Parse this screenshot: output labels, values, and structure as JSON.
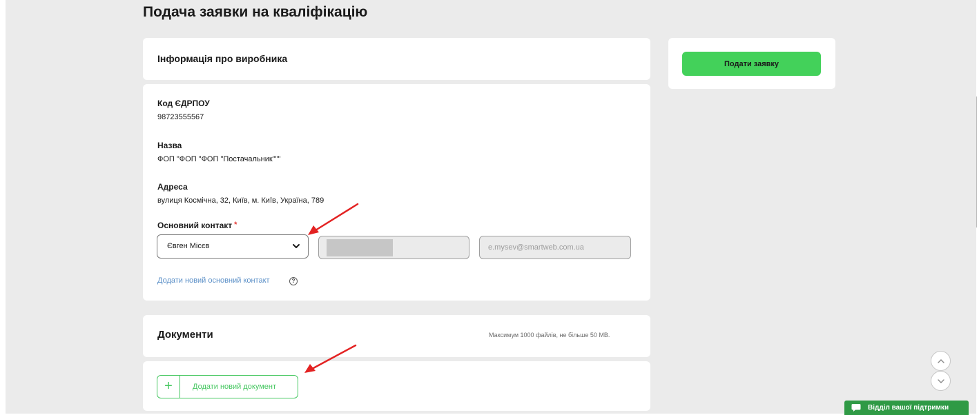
{
  "page": {
    "title": "Подача заявки на кваліфікацію"
  },
  "producer": {
    "title": "Інформація про виробника",
    "edrpou": {
      "label": "Код ЄДРПОУ",
      "value": "98723555567"
    },
    "name": {
      "label": "Назва",
      "value": "ФОП \"ФОП \"ФОП \"Постачальник\"\"\""
    },
    "address": {
      "label": "Адреса",
      "value": "вулиця Космічна, 32, Київ, м. Київ, Україна, 789"
    },
    "main_contact": {
      "label": "Основний контакт",
      "required_mark": "*",
      "selected": "Євген Місєв",
      "email": "e.mysev@smartweb.com.ua"
    },
    "add_contact_link": "Додати новий основний контакт",
    "help_glyph": "?"
  },
  "documents": {
    "title": "Документи",
    "note": "Максимум 1000 файлів, не більше 50 MB.",
    "add_label": "Додати новий документ",
    "add_glyph": "+"
  },
  "sidebar": {
    "submit_label": "Подати заявку"
  },
  "support": {
    "label": "Відділ вашої підтримки"
  },
  "colors": {
    "accent_green": "#43d15a",
    "support_green": "#2f9a45",
    "link_blue": "#5a8fc7",
    "annotation_red": "#e32222"
  },
  "icons": {
    "chevron": "chevron-down-icon",
    "help": "question-icon",
    "plus": "plus-icon",
    "scroll_up": "chevron-up-icon",
    "scroll_down": "chevron-down-icon",
    "chat": "chat-bubble-icon"
  }
}
